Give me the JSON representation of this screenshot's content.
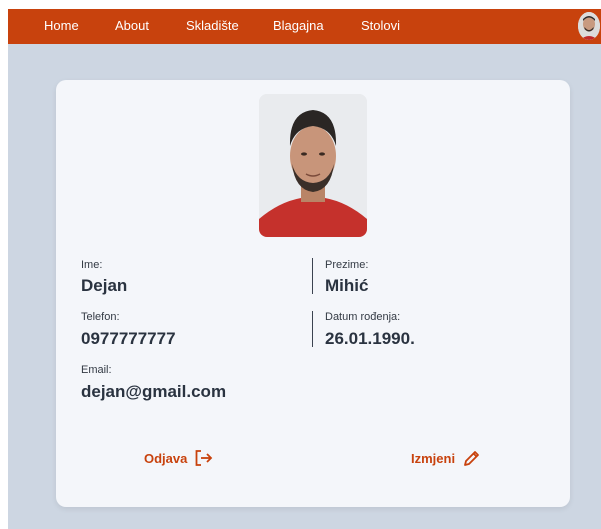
{
  "nav": {
    "items": [
      "Home",
      "About",
      "Skladište",
      "Blagajna",
      "Stolovi"
    ]
  },
  "profile": {
    "first_name": {
      "label": "Ime:",
      "value": "Dejan"
    },
    "last_name": {
      "label": "Prezime:",
      "value": "Mihić"
    },
    "phone": {
      "label": "Telefon:",
      "value": "0977777777"
    },
    "birth_date": {
      "label": "Datum rođenja:",
      "value": "26.01.1990."
    },
    "email": {
      "label": "Email:",
      "value": "dejan@gmail.com"
    }
  },
  "actions": {
    "logout_label": "Odjava",
    "edit_label": "Izmjeni"
  },
  "icons": {
    "logout": "logout-icon",
    "edit": "pencil-icon"
  },
  "colors": {
    "brand": "#c8420d",
    "page_bg": "#cdd6e2",
    "card_bg": "#f4f6fa",
    "text": "#2a3340"
  }
}
